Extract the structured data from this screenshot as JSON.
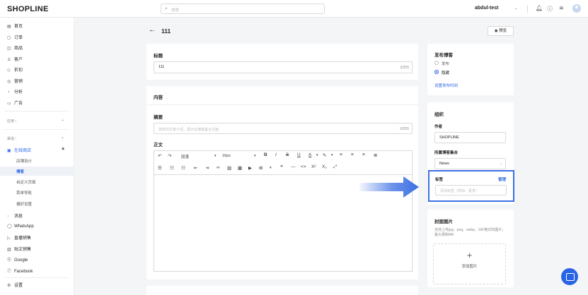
{
  "topbar": {
    "logo": "SHOPLINE",
    "search_placeholder": "搜索",
    "store_name": "abdul-test"
  },
  "sidebar": {
    "items": [
      {
        "icon": "home-icon",
        "label": "首页"
      },
      {
        "icon": "order-icon",
        "label": "订单"
      },
      {
        "icon": "product-icon",
        "label": "商品"
      },
      {
        "icon": "customer-icon",
        "label": "客户"
      },
      {
        "icon": "discount-icon",
        "label": "折扣"
      },
      {
        "icon": "marketing-icon",
        "label": "营销"
      },
      {
        "icon": "analytics-icon",
        "label": "分析"
      },
      {
        "icon": "ads-icon",
        "label": "广告"
      }
    ],
    "section_apps": "应用",
    "section_channels": "渠道",
    "online_store": "在线商店",
    "online_store_subs": [
      "店铺设计",
      "博客",
      "自定义页面",
      "菜单导航",
      "偏好设置"
    ],
    "channels": [
      {
        "icon": "message-icon",
        "label": "消息"
      },
      {
        "icon": "whatsapp-icon",
        "label": "WhatsApp"
      },
      {
        "icon": "live-icon",
        "label": "直播销售"
      },
      {
        "icon": "post-icon",
        "label": "贴文销售"
      },
      {
        "icon": "google-icon",
        "label": "Google"
      },
      {
        "icon": "facebook-icon",
        "label": "Facebook"
      }
    ],
    "settings": "设置"
  },
  "page": {
    "title": "111",
    "preview_label": "预览"
  },
  "title_card": {
    "label": "标题",
    "value": "111",
    "count": "3/255"
  },
  "content_card": {
    "label": "内容",
    "summary_label": "摘要",
    "summary_placeholder": "简单的文章介绍，展示在博客集合页面",
    "summary_count": "0/255",
    "body_label": "正文",
    "paragraph_select": "段落",
    "font_size": "16px"
  },
  "publish_card": {
    "label": "发布博客",
    "option_publish": "发布",
    "option_hidden": "隐藏",
    "schedule_link": "设置发布时间"
  },
  "org_card": {
    "label": "组织",
    "author_label": "作者",
    "author_value": "SHOPLINE",
    "collection_label": "所属博客集合",
    "collection_value": "News",
    "tags_label": "标签",
    "tags_manage": "管理",
    "tags_placeholder": "添加标签（例如：夏季）"
  },
  "cover_card": {
    "label": "封面图片",
    "hint": "支持上传jpg、png、webp、GIF格式的图片；最大限制4M",
    "add_label": "添加图片"
  },
  "colors": {
    "accent": "#2a64e6",
    "highlight_border": "#3b6fe3"
  }
}
